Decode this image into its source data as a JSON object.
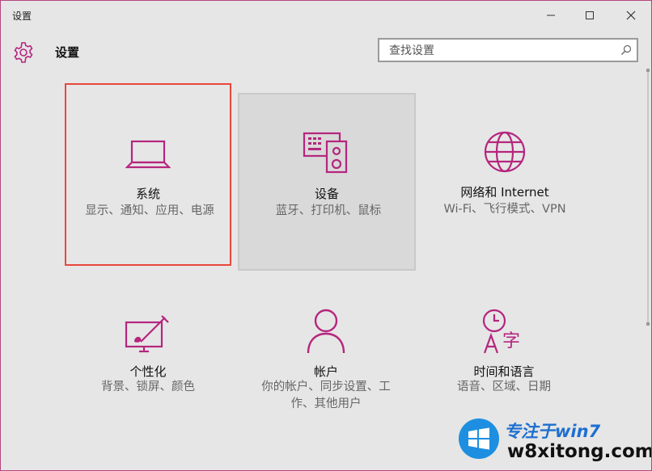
{
  "window": {
    "title": "设置"
  },
  "header": {
    "title": "设置"
  },
  "search": {
    "placeholder": "查找设置"
  },
  "tiles": [
    {
      "name": "系统",
      "desc": "显示、通知、应用、电源"
    },
    {
      "name": "设备",
      "desc": "蓝牙、打印机、鼠标"
    },
    {
      "name": "网络和 Internet",
      "desc": "Wi-Fi、飞行模式、VPN"
    },
    {
      "name": "个性化",
      "desc": "背景、锁屏、颜色"
    },
    {
      "name": "帐户",
      "desc": "你的帐户、同步设置、工作、其他用户"
    },
    {
      "name": "时间和语言",
      "desc": "语音、区域、日期"
    }
  ],
  "watermark": {
    "top": "专注于win7",
    "bottom": "w8xitong.com"
  },
  "colors": {
    "accent": "#b5267e",
    "selection": "#e8473d",
    "background": "#e6e6e6"
  },
  "icons": [
    "settings-gear-icon",
    "search-icon",
    "minimize-icon",
    "maximize-icon",
    "close-icon",
    "laptop-icon",
    "keyboard-speaker-icon",
    "globe-icon",
    "personalize-icon",
    "person-icon",
    "time-language-icon",
    "windows-logo-icon"
  ]
}
